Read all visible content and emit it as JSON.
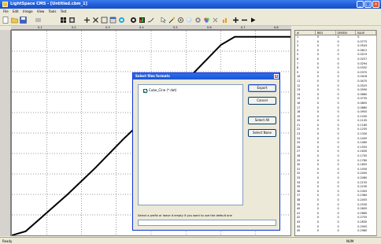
{
  "window": {
    "title": "LightSpace CMS - [Untitled.cbm_1]",
    "controls": {
      "minimize": "_",
      "maximize": "□",
      "close": "×"
    }
  },
  "menu": [
    "File",
    "Edit",
    "Image",
    "View",
    "Tools",
    "Test"
  ],
  "ruler": {
    "top_ticks": [
      "0.1",
      "0.2",
      "0.3",
      "0.4",
      "0.5",
      "0.6",
      "0.7",
      "0.8"
    ]
  },
  "table": {
    "columns": [
      "#",
      "RED",
      "GREEN",
      "BLUE"
    ],
    "rows": [
      [
        "1",
        "0",
        "0",
        "0"
      ],
      [
        "2",
        "0",
        "0",
        "0.0775"
      ],
      [
        "3",
        "0",
        "0",
        "0.0543"
      ],
      [
        "4",
        "0",
        "0",
        "0.0612"
      ],
      [
        "5",
        "0",
        "0",
        "0.0219"
      ],
      [
        "6",
        "0",
        "0",
        "0.0257"
      ],
      [
        "7",
        "0",
        "0",
        "0.0294"
      ],
      [
        "8",
        "0",
        "0",
        "0.0332"
      ],
      [
        "9",
        "0",
        "0",
        "0.0370"
      ],
      [
        "10",
        "0",
        "0",
        "0.0418"
      ],
      [
        "11",
        "0",
        "0",
        "0.0470"
      ],
      [
        "12",
        "0",
        "0",
        "0.0525"
      ],
      [
        "13",
        "0",
        "0",
        "0.0590"
      ],
      [
        "14",
        "0",
        "0",
        "0.0660"
      ],
      [
        "15",
        "0",
        "0",
        "0.0735"
      ],
      [
        "16",
        "0",
        "0",
        "0.0805"
      ],
      [
        "17",
        "0",
        "0",
        "0.0880"
      ],
      [
        "18",
        "0",
        "0",
        "0.0955"
      ],
      [
        "19",
        "0",
        "0",
        "0.1030"
      ],
      [
        "20",
        "0",
        "0",
        "0.1105"
      ],
      [
        "21",
        "0",
        "0",
        "0.1180"
      ],
      [
        "22",
        "0",
        "0",
        "0.1255"
      ],
      [
        "23",
        "0",
        "0",
        "0.1330"
      ],
      [
        "24",
        "0",
        "0",
        "0.1405"
      ],
      [
        "25",
        "0",
        "0",
        "0.1480"
      ],
      [
        "26",
        "0",
        "0",
        "0.1555"
      ],
      [
        "27",
        "0",
        "0",
        "0.1630"
      ],
      [
        "28",
        "0",
        "0",
        "0.1705"
      ],
      [
        "29",
        "0",
        "0",
        "0.1780"
      ],
      [
        "30",
        "0",
        "0",
        "0.1855"
      ],
      [
        "31",
        "0",
        "0",
        "0.1930"
      ],
      [
        "32",
        "0",
        "0",
        "0.2005"
      ],
      [
        "33",
        "0",
        "0",
        "0.2080"
      ],
      [
        "34",
        "0",
        "0",
        "0.2155"
      ],
      [
        "35",
        "0",
        "0",
        "0.2230"
      ],
      [
        "36",
        "0",
        "0",
        "0.2305"
      ],
      [
        "37",
        "0",
        "0",
        "0.2380"
      ],
      [
        "38",
        "0",
        "0",
        "0.2455"
      ],
      [
        "39",
        "0",
        "0",
        "0.2530"
      ],
      [
        "40",
        "0",
        "0",
        "0.2605"
      ],
      [
        "41",
        "0",
        "0",
        "0.2680"
      ],
      [
        "42",
        "0",
        "0",
        "0.2755"
      ],
      [
        "43",
        "0",
        "0",
        "0.2830"
      ],
      [
        "44",
        "0",
        "0",
        "0.2905"
      ],
      [
        "45",
        "0",
        "0",
        "0.2980"
      ]
    ]
  },
  "dialog": {
    "title": "Select files formats",
    "list_items": [
      {
        "label": "Cube_Cine (*.dat)",
        "checked": true
      }
    ],
    "buttons": {
      "export": "Export",
      "cancel": "Cancel",
      "select_all": "Select All",
      "select_none": "Select None"
    },
    "prompt": "Select a prefix or leave it empty if you want to use the default one",
    "input_value": ""
  },
  "status": {
    "left": "Ready",
    "right": "NUM"
  },
  "colors": {
    "titlebar": "#1f5bd6",
    "curve": "#000000",
    "gridline": "#000000",
    "close": "#d8502e"
  },
  "chart_data": {
    "type": "line",
    "title": "",
    "xlabel": "",
    "ylabel": "",
    "xlim": [
      0,
      1
    ],
    "ylim": [
      0,
      1
    ],
    "grid": true,
    "series": [
      {
        "name": "",
        "x": [
          0.0,
          0.05,
          0.1,
          0.2,
          0.3,
          0.4,
          0.5,
          0.6,
          0.7,
          0.75,
          0.8,
          1.0
        ],
        "y": [
          0.0,
          0.02,
          0.08,
          0.2,
          0.33,
          0.47,
          0.6,
          0.72,
          0.86,
          0.93,
          0.97,
          0.97
        ]
      }
    ]
  }
}
